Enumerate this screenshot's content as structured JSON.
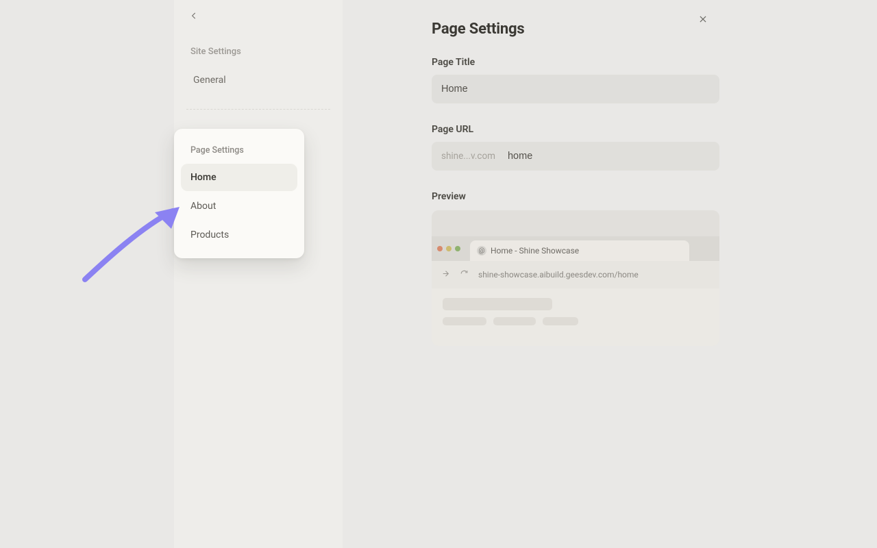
{
  "sidebar": {
    "back_aria": "Back",
    "section_label": "Site Settings",
    "items": [
      {
        "label": "General"
      }
    ]
  },
  "page_settings_card": {
    "label": "Page Settings",
    "pages": [
      {
        "label": "Home",
        "active": true
      },
      {
        "label": "About",
        "active": false
      },
      {
        "label": "Products",
        "active": false
      }
    ]
  },
  "main": {
    "heading": "Page Settings",
    "close_aria": "Close",
    "page_title_label": "Page Title",
    "page_title_value": "Home",
    "page_url_label": "Page URL",
    "page_url_prefix": "shine...v.com",
    "page_url_value": "home",
    "preview_label": "Preview",
    "preview_tab_title": "Home - Shine Showcase",
    "preview_url": "shine-showcase.aibuild.geesdev.com/home"
  }
}
